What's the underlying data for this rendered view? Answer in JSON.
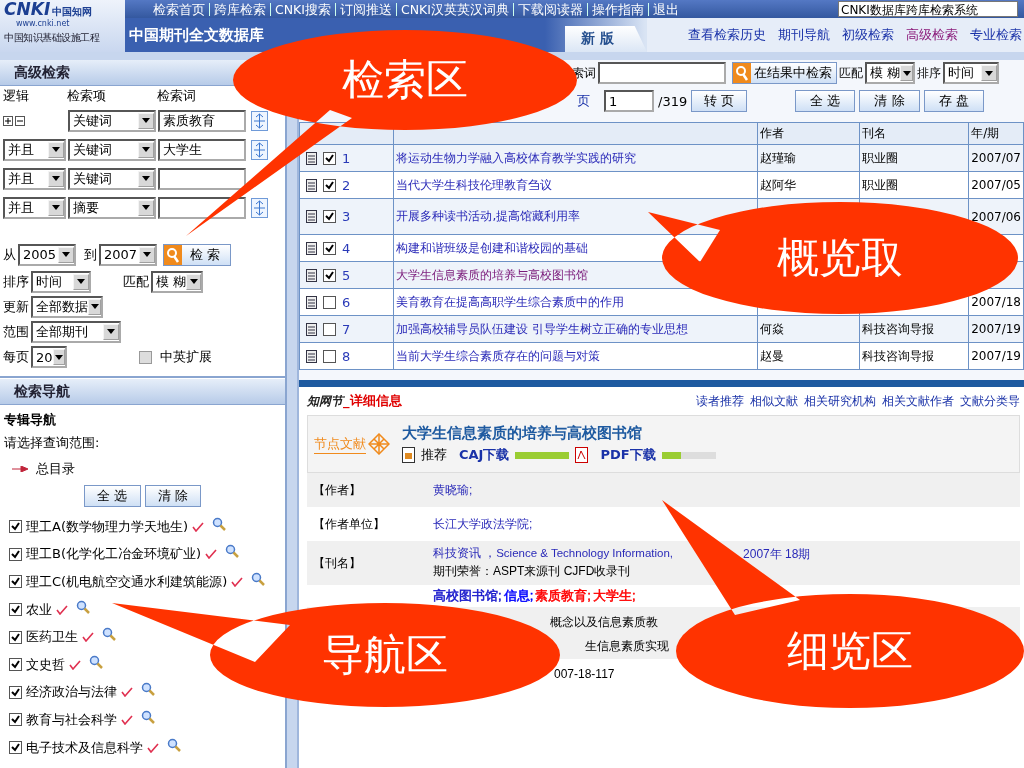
{
  "header": {
    "logo": {
      "mark": "CNKI",
      "name": "中国知网",
      "url": "www.cnki.net",
      "tagline": "中国知识基础设施工程"
    },
    "nav_links": [
      "检索首页",
      "跨库检索",
      "CNKI搜索",
      "订阅推送",
      "CNKI汉英英汉词典",
      "下载阅读器",
      "操作指南",
      "退出"
    ],
    "system_field": "CNKI数据库跨库检索系统",
    "database_title": "中国期刊全文数据库",
    "version_tab": "新 版",
    "mode_links": [
      {
        "label": "查看检索历史",
        "selected": false
      },
      {
        "label": "期刊导航",
        "selected": false
      },
      {
        "label": "初级检索",
        "selected": false
      },
      {
        "label": "高级检索",
        "selected": true
      },
      {
        "label": "专业检索",
        "selected": false
      }
    ]
  },
  "search_panel": {
    "title": "高级检索",
    "column_labels": [
      "逻辑",
      "检索项",
      "检索词"
    ],
    "rows": [
      {
        "kind": "first",
        "field": "关键词",
        "term": "素质教育"
      },
      {
        "kind": "joined",
        "logic": "并且",
        "field": "关键词",
        "term": "大学生"
      },
      {
        "kind": "joined",
        "logic": "并且",
        "field": "关键词"
      },
      {
        "kind": "joined",
        "logic": "并且",
        "field": "摘要"
      }
    ],
    "years": {
      "from_label": "从",
      "from": "2005",
      "to_label": "到",
      "to": "2007",
      "search_button": "检 索"
    },
    "sort": {
      "label": "排序",
      "value": "时间"
    },
    "match": {
      "label": "匹配",
      "value": "模 糊"
    },
    "update": {
      "label": "更新",
      "value": "全部数据"
    },
    "scope": {
      "label": "范围",
      "value": "全部期刊"
    },
    "per_page": {
      "label": "每页",
      "value": "20"
    },
    "bilingual": {
      "label": "中英扩展",
      "checked": false
    }
  },
  "nav_panel": {
    "title": "检索导航",
    "subtitle": "专辑导航",
    "prompt": "请选择查询范围:",
    "root": "总目录",
    "buttons": [
      "全 选",
      "清 除"
    ],
    "categories": [
      {
        "label": "理工A(数学物理力学天地生)",
        "checked": true
      },
      {
        "label": "理工B(化学化工冶金环境矿业)",
        "checked": true
      },
      {
        "label": "理工C(机电航空交通水利建筑能源)",
        "checked": true
      },
      {
        "label": "农业",
        "checked": true
      },
      {
        "label": "医药卫生",
        "checked": true
      },
      {
        "label": "文史哲",
        "checked": true
      },
      {
        "label": "经济政治与法律",
        "checked": true
      },
      {
        "label": "教育与社会科学",
        "checked": true
      },
      {
        "label": "电子技术及信息科学",
        "checked": true
      }
    ]
  },
  "results": {
    "search_in": {
      "label": "索词",
      "button": "在结果中检索",
      "match_label": "匹配",
      "match": "模 糊",
      "sort_label": "排序",
      "sort": "时间"
    },
    "pager": {
      "link": "页",
      "page": "1",
      "total": "/319",
      "go_button": "转 页",
      "actions": [
        "全 选",
        "清 除",
        "存 盘"
      ]
    },
    "columns": [
      "作者",
      "刊名",
      "年/期"
    ],
    "rows": [
      {
        "number": "1",
        "checked": true,
        "visited": false,
        "title": "将运动生物力学融入高校体育教学实践的研究",
        "author": "赵瑾瑜",
        "journal": "职业圈",
        "issue": "2007/07"
      },
      {
        "number": "2",
        "checked": true,
        "visited": false,
        "title": "当代大学生科技伦理教育刍议",
        "author": "赵阿华",
        "journal": "职业圈",
        "issue": "2007/05"
      },
      {
        "number": "3",
        "checked": true,
        "visited": false,
        "title": "开展多种读书活动,提高馆藏利用率",
        "issue": "2007/06"
      },
      {
        "number": "4",
        "checked": true,
        "visited": false,
        "title": "构建和谐班级是创建和谐校园的基础"
      },
      {
        "number": "5",
        "checked": true,
        "visited": true,
        "title": "大学生信息素质的培养与高校图书馆"
      },
      {
        "number": "6",
        "checked": false,
        "visited": false,
        "title": "美育教育在提高高职学生综合素质中的作用",
        "issue": "2007/18"
      },
      {
        "number": "7",
        "checked": false,
        "visited": false,
        "title": "加强高校辅导员队伍建设 引导学生树立正确的专业思想",
        "author": "何焱",
        "journal": "科技咨询导报",
        "issue": "2007/19"
      },
      {
        "number": "8",
        "checked": false,
        "visited": false,
        "title": "当前大学生综合素质存在的问题与对策",
        "author": "赵曼",
        "journal": "科技咨询导报",
        "issue": "2007/19"
      }
    ]
  },
  "detail": {
    "brand": "知网节",
    "heading": "_详细信息",
    "links": [
      "读者推荐",
      "相似文献",
      "相关研究机构",
      "相关文献作者",
      "文献分类导"
    ],
    "logo_text": "节点文献",
    "title": "大学生信息素质的培养与高校图书馆",
    "recommend": "推荐",
    "downloads": [
      {
        "label": "CAJ下载",
        "level": 1
      },
      {
        "label": "PDF下载",
        "level": 0.35
      }
    ],
    "fields": [
      {
        "kind": "links",
        "label": "【作者】",
        "items": [
          {
            "text": "黄晓瑜;"
          }
        ]
      },
      {
        "kind": "links",
        "label": "【作者单位】",
        "items": [
          {
            "text": "长江大学政法学院;"
          }
        ]
      },
      {
        "kind": "journal",
        "label": "【刊名】",
        "source": "科技资讯 ，Science & Technology Information,",
        "issue": "2007年  18期",
        "honors": "期刊荣誉：ASPT来源刊  CJFD收录刊"
      },
      {
        "kind": "links",
        "items": [
          {
            "text": "高校图书馆;",
            "color": "#1a1acc"
          },
          {
            "text": "信息;",
            "color": "#0000ff"
          },
          {
            "text": "素质教育;",
            "color": "#ff0000"
          },
          {
            "text": "大学生;",
            "color": "#ff0000"
          }
        ]
      },
      {
        "kind": "text",
        "lines": [
          "概念以及信息素质教",
          "生信息素质实现"
        ]
      },
      {
        "kind": "text",
        "lines": [
          "007-18-117"
        ]
      }
    ]
  },
  "callouts": [
    {
      "label": "检索区"
    },
    {
      "label": "概览取"
    },
    {
      "label": "导航区"
    },
    {
      "label": "细览区"
    }
  ]
}
